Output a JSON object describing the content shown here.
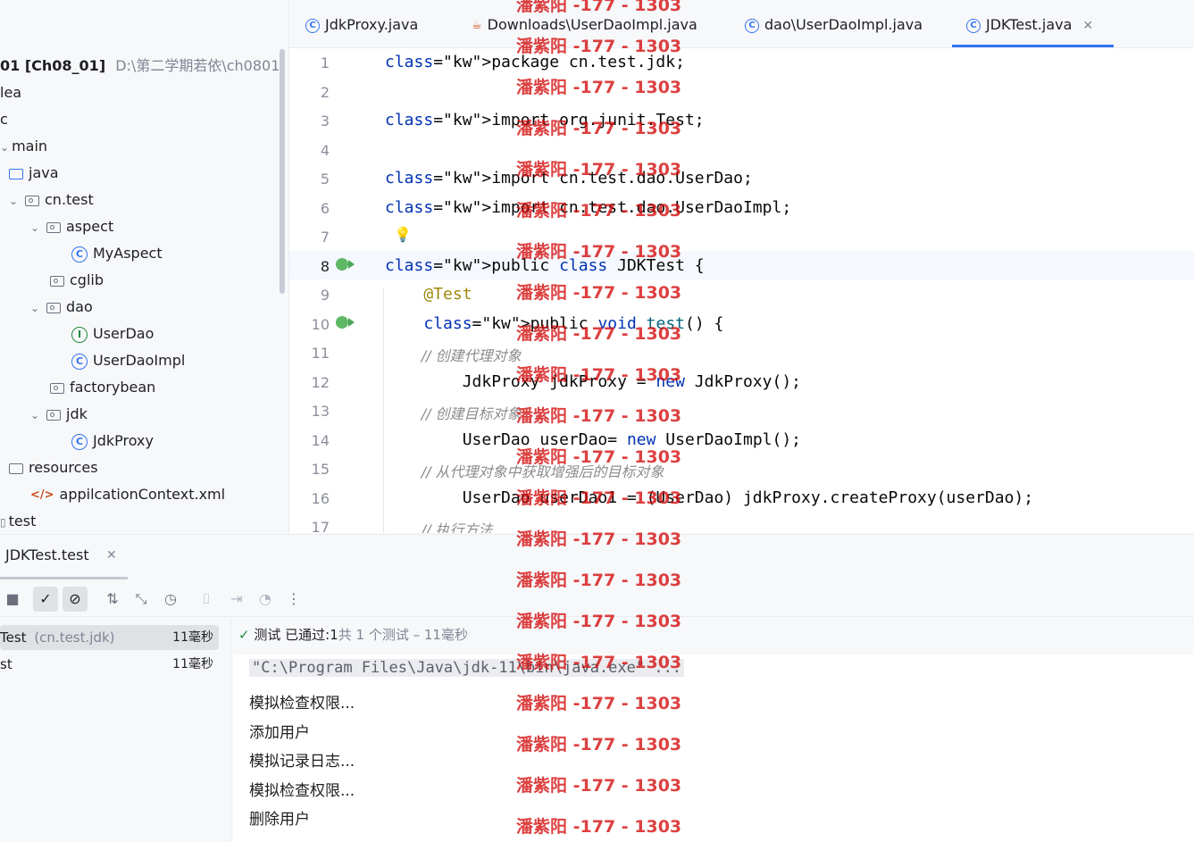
{
  "project": {
    "root_name": "01 [Ch08_01]",
    "root_path": "D:\\第二学期若依\\ch0801",
    "items": [
      {
        "label": "lea"
      },
      {
        "label": "c"
      },
      {
        "label": "main"
      },
      {
        "label": "java"
      },
      {
        "label": "cn.test"
      },
      {
        "label": "aspect"
      },
      {
        "label": "MyAspect"
      },
      {
        "label": "cglib"
      },
      {
        "label": "dao"
      },
      {
        "label": "UserDao"
      },
      {
        "label": "UserDaoImpl"
      },
      {
        "label": "factorybean"
      },
      {
        "label": "jdk"
      },
      {
        "label": "JdkProxy"
      },
      {
        "label": "resources"
      },
      {
        "label": "appilcationContext.xml"
      },
      {
        "label": "test"
      }
    ]
  },
  "tabs": [
    {
      "label": "JdkProxy.java"
    },
    {
      "label": "Downloads\\UserDaoImpl.java"
    },
    {
      "label": "dao\\UserDaoImpl.java"
    },
    {
      "label": "JDKTest.java",
      "active": true
    }
  ],
  "editor": {
    "lines": [
      {
        "n": "1",
        "text": "package cn.test.jdk;"
      },
      {
        "n": "2",
        "text": ""
      },
      {
        "n": "3",
        "text": "import org.junit.Test;"
      },
      {
        "n": "4",
        "text": ""
      },
      {
        "n": "5",
        "text": "import cn.test.dao.UserDao;"
      },
      {
        "n": "6",
        "text": "import cn.test.dao.UserDaoImpl;"
      },
      {
        "n": "7",
        "text": ""
      },
      {
        "n": "8",
        "text": "public class JDKTest {"
      },
      {
        "n": "9",
        "text": "    @Test"
      },
      {
        "n": "10",
        "text": "    public void test() {"
      },
      {
        "n": "11",
        "text": "        // 创建代理对象"
      },
      {
        "n": "12",
        "text": "        JdkProxy jdkProxy = new JdkProxy();"
      },
      {
        "n": "13",
        "text": "        // 创建目标对象"
      },
      {
        "n": "14",
        "text": "        UserDao userDao= new UserDaoImpl();"
      },
      {
        "n": "15",
        "text": "        // 从代理对象中获取增强后的目标对象"
      },
      {
        "n": "16",
        "text": "        UserDao userDao1 = (UserDao) jdkProxy.createProxy(userDao);"
      },
      {
        "n": "17",
        "text": "        // 执行方法"
      }
    ]
  },
  "run": {
    "tab_label": "JDKTest.test",
    "tests": [
      {
        "name": "Test",
        "pkg": "(cn.test.jdk)",
        "time": "11毫秒"
      },
      {
        "name": "st",
        "time": "11毫秒"
      }
    ],
    "status": {
      "prefix": "测试 已通过:",
      "passed": "1",
      "total_text": "共 1 个测试",
      "sep": " – ",
      "time": "11毫秒"
    },
    "output": [
      "\"C:\\Program Files\\Java\\jdk-11\\bin\\java.exe\" ...",
      "模拟检查权限...",
      "添加用户",
      "模拟记录日志...",
      "模拟检查权限...",
      "删除用户"
    ]
  },
  "watermark": "潘紫阳 -177 - 1303",
  "colors": {
    "accent": "#3574f0",
    "keyword": "#0033b3",
    "annotation": "#9e880d",
    "success": "#208a3c",
    "watermark": "#d40b0b"
  }
}
